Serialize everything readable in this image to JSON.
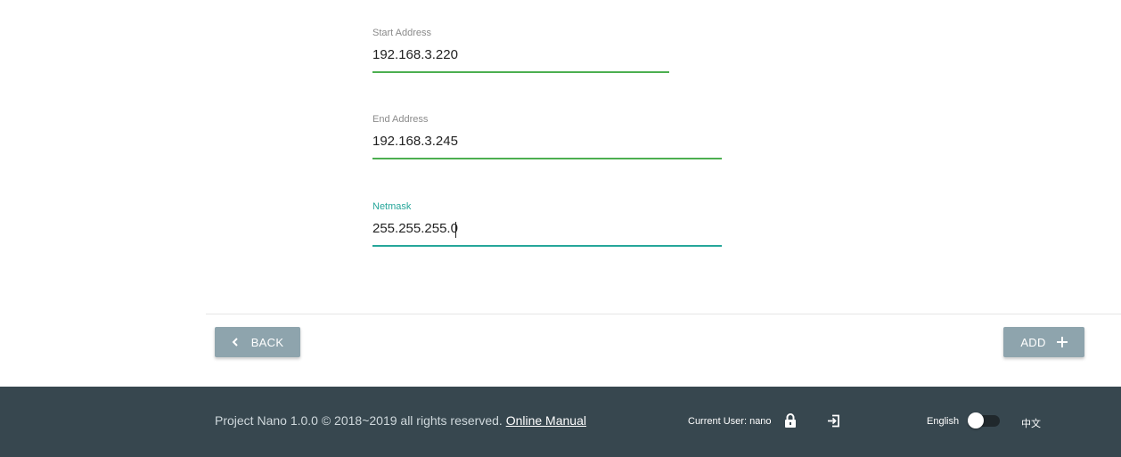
{
  "form": {
    "start_address": {
      "label": "Start Address",
      "value": "192.168.3.220"
    },
    "end_address": {
      "label": "End Address",
      "value": "192.168.3.245"
    },
    "netmask": {
      "label": "Netmask",
      "value": "255.255.255.0",
      "focused": true
    }
  },
  "actions": {
    "back_label": "BACK",
    "back_icon": "chevron-left-icon",
    "add_label": "ADD",
    "add_icon": "plus-icon"
  },
  "footer": {
    "copyright": "Project Nano 1.0.0 © 2018~2019 all rights reserved.",
    "manual_link": "Online Manual",
    "current_user": "Current User: nano",
    "lock_icon": "lock-icon",
    "logout_icon": "logout-icon",
    "lang_english": "English",
    "lang_chinese": "中文"
  },
  "colors": {
    "valid_underline": "#4caf50",
    "focus_accent": "#26a69a",
    "button_bg": "#8ea4ad",
    "footer_bg": "#37474f"
  }
}
